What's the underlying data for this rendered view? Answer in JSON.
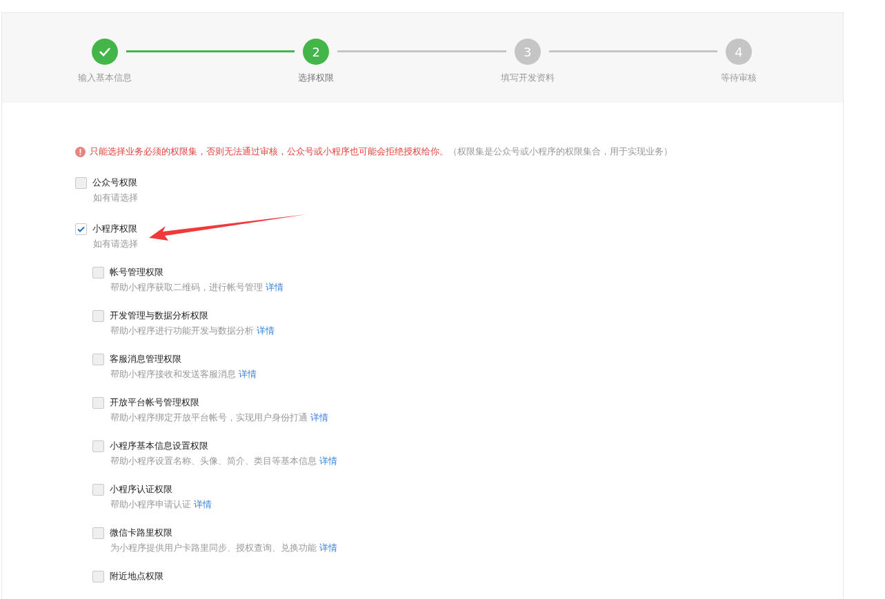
{
  "steps": [
    {
      "label": "输入基本信息",
      "done": true,
      "selected": false
    },
    {
      "number": "2",
      "label": "选择权限",
      "done": false,
      "selected": true
    },
    {
      "number": "3",
      "label": "填写开发资料",
      "done": false,
      "selected": false
    },
    {
      "number": "4",
      "label": "等待审核",
      "done": false,
      "selected": false
    }
  ],
  "notice": {
    "warning": "只能选择业务必须的权限集，否则无法通过审核，公众号或小程序也可能会拒绝授权给你。",
    "note": "（权限集是公众号或小程序的权限集合，用于实现业务）"
  },
  "permissions": [
    {
      "label": "公众号权限",
      "hint": "如有请选择",
      "checked": false
    },
    {
      "label": "小程序权限",
      "hint": "如有请选择",
      "checked": true,
      "children": [
        {
          "label": "帐号管理权限",
          "description": "帮助小程序获取二维码，进行帐号管理",
          "link": "详情",
          "checked": false
        },
        {
          "label": "开发管理与数据分析权限",
          "description": "帮助小程序进行功能开发与数据分析",
          "link": "详情",
          "checked": false
        },
        {
          "label": "客服消息管理权限",
          "description": "帮助小程序接收和发送客服消息",
          "link": "详情",
          "checked": false
        },
        {
          "label": "开放平台帐号管理权限",
          "description": "帮助小程序绑定开放平台帐号，实现用户身份打通",
          "link": "详情",
          "checked": false
        },
        {
          "label": "小程序基本信息设置权限",
          "description": "帮助小程序设置名称、头像、简介、类目等基本信息",
          "link": "详情",
          "checked": false
        },
        {
          "label": "小程序认证权限",
          "description": "帮助小程序申请认证",
          "link": "详情",
          "checked": false
        },
        {
          "label": "微信卡路里权限",
          "description": "为小程序提供用户卡路里同步、授权查询、兑换功能",
          "link": "详情",
          "checked": false
        },
        {
          "label": "附近地点权限",
          "checked": false
        }
      ]
    }
  ]
}
